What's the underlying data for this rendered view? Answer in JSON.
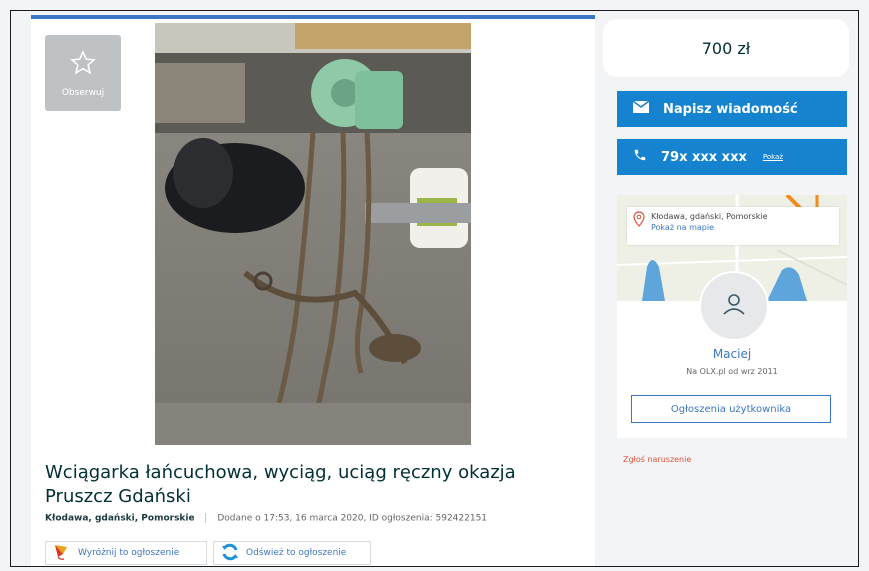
{
  "colors": {
    "accent_blue": "#1583cf",
    "link_blue": "#3b77c4",
    "report_red": "#e0533c"
  },
  "ad": {
    "observe_label": "Obserwuj",
    "title": "Wciągarka łańcuchowa, wyciąg, uciąg ręczny okazja Pruszcz Gdański",
    "location": "Kłodawa, gdański, Pomorskie",
    "added": "Dodane o 17:53, 16 marca 2020, ID ogłoszenia: 592422151",
    "promote_label": "Wyróżnij to ogłoszenie",
    "refresh_label": "Odśwież to ogłoszenie"
  },
  "sidebar": {
    "price": "700 zł",
    "message_button": "Napisz wiadomość",
    "phone_masked": "79x xxx xxx",
    "phone_show": "Pokaż",
    "map_location": "Kłodawa, gdański, Pomorskie",
    "map_link": "Pokaż na mapie",
    "seller_name": "Maciej",
    "seller_since": "Na OLX.pl od wrz 2011",
    "seller_ads_button": "Ogłoszenia użytkownika",
    "report_link": "Zgłoś naruszenie"
  },
  "icons": [
    "star-icon",
    "envelope-icon",
    "phone-icon",
    "map-pin-icon",
    "user-icon",
    "promote-kite-icon",
    "refresh-icon"
  ]
}
